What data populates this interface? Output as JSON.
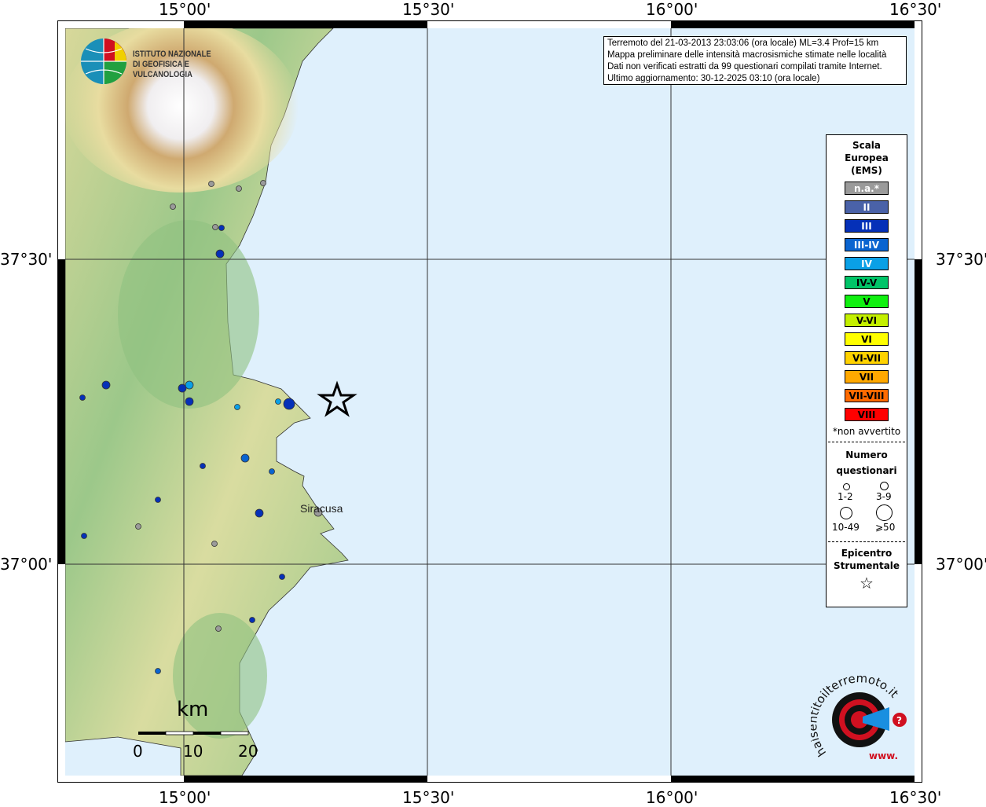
{
  "map": {
    "lon_ticks": [
      "15°00'",
      "15°30'",
      "16°00'",
      "16°30'"
    ],
    "lat_ticks": [
      "37°30'",
      "37°00'"
    ],
    "place_label": "Siracusa",
    "scale_bar": {
      "unit": "km",
      "labels": [
        "0",
        "10",
        "20"
      ]
    },
    "land_color": "#9cc88a",
    "sea_color": "#dff0fc",
    "points": [
      {
        "intensity": "n.a.",
        "q": "1-2"
      },
      {
        "intensity": "n.a.",
        "q": "1-2"
      },
      {
        "intensity": "n.a.",
        "q": "1-2"
      },
      {
        "intensity": "n.a.",
        "q": "1-2"
      },
      {
        "intensity": "n.a.",
        "q": "1-2"
      },
      {
        "intensity": "n.a.",
        "q": "1-2"
      },
      {
        "intensity": "n.a.",
        "q": "1-2"
      },
      {
        "intensity": "n.a.",
        "q": "1-2"
      },
      {
        "intensity": "n.a.",
        "q": "3-9"
      },
      {
        "intensity": "III",
        "q": "1-2"
      },
      {
        "intensity": "III",
        "q": "3-9"
      },
      {
        "intensity": "III",
        "q": "3-9"
      },
      {
        "intensity": "III",
        "q": "1-2"
      },
      {
        "intensity": "III",
        "q": "3-9"
      },
      {
        "intensity": "III",
        "q": "3-9"
      },
      {
        "intensity": "III",
        "q": "10-49"
      },
      {
        "intensity": "III",
        "q": "1-2"
      },
      {
        "intensity": "III",
        "q": "3-9"
      },
      {
        "intensity": "III",
        "q": "1-2"
      },
      {
        "intensity": "III",
        "q": "1-2"
      },
      {
        "intensity": "III",
        "q": "1-2"
      },
      {
        "intensity": "III",
        "q": "1-2"
      },
      {
        "intensity": "III-IV",
        "q": "3-9"
      },
      {
        "intensity": "III-IV",
        "q": "1-2"
      },
      {
        "intensity": "III-IV",
        "q": "1-2"
      },
      {
        "intensity": "IV",
        "q": "3-9"
      },
      {
        "intensity": "IV",
        "q": "1-2"
      },
      {
        "intensity": "IV",
        "q": "1-2"
      }
    ]
  },
  "info": {
    "lines": [
      "Terremoto del 21-03-2013 23:03:06 (ora locale) ML=3.4 Prof=15 km",
      "Mappa preliminare delle intensità macrosismiche stimate nelle località",
      "Dati non verificati estratti da 99 questionari compilati tramite Internet.",
      "Ultimo aggiornamento: 30-12-2025 03:10 (ora locale)"
    ]
  },
  "legend": {
    "title": [
      "Scala",
      "Europea",
      "(EMS)"
    ],
    "scale": [
      {
        "label": "n.a.*",
        "color": "#9a9a9a",
        "text": "#ffffff"
      },
      {
        "label": "II",
        "color": "#4a62a8",
        "text": "#ffffff"
      },
      {
        "label": "III",
        "color": "#0530b8",
        "text": "#ffffff"
      },
      {
        "label": "III-IV",
        "color": "#0a64d0",
        "text": "#ffffff"
      },
      {
        "label": "IV",
        "color": "#0aa0e6",
        "text": "#ffffff"
      },
      {
        "label": "IV-V",
        "color": "#00c468",
        "text": "#000000"
      },
      {
        "label": "V",
        "color": "#10f010",
        "text": "#000000"
      },
      {
        "label": "V-VI",
        "color": "#c4f000",
        "text": "#000000"
      },
      {
        "label": "VI",
        "color": "#ffff00",
        "text": "#000000"
      },
      {
        "label": "VI-VII",
        "color": "#ffd200",
        "text": "#000000"
      },
      {
        "label": "VII",
        "color": "#ffa800",
        "text": "#000000"
      },
      {
        "label": "VII-VIII",
        "color": "#ff6a00",
        "text": "#000000"
      },
      {
        "label": "VIII",
        "color": "#ff0000",
        "text": "#000000"
      }
    ],
    "note": "*non avvertito",
    "questionnaires_title": [
      "Numero",
      "questionari"
    ],
    "questionnaire_classes": [
      "1-2",
      "3-9",
      "10-49",
      "⩾50"
    ],
    "epicenter_title": [
      "Epicentro",
      "Strumentale"
    ]
  },
  "logos": {
    "ingv": "ISTITUTO NAZIONALE DI GEOFISICA E VULCANOLOGIA",
    "hsit": "www.haisentitoilterremoto.it"
  }
}
